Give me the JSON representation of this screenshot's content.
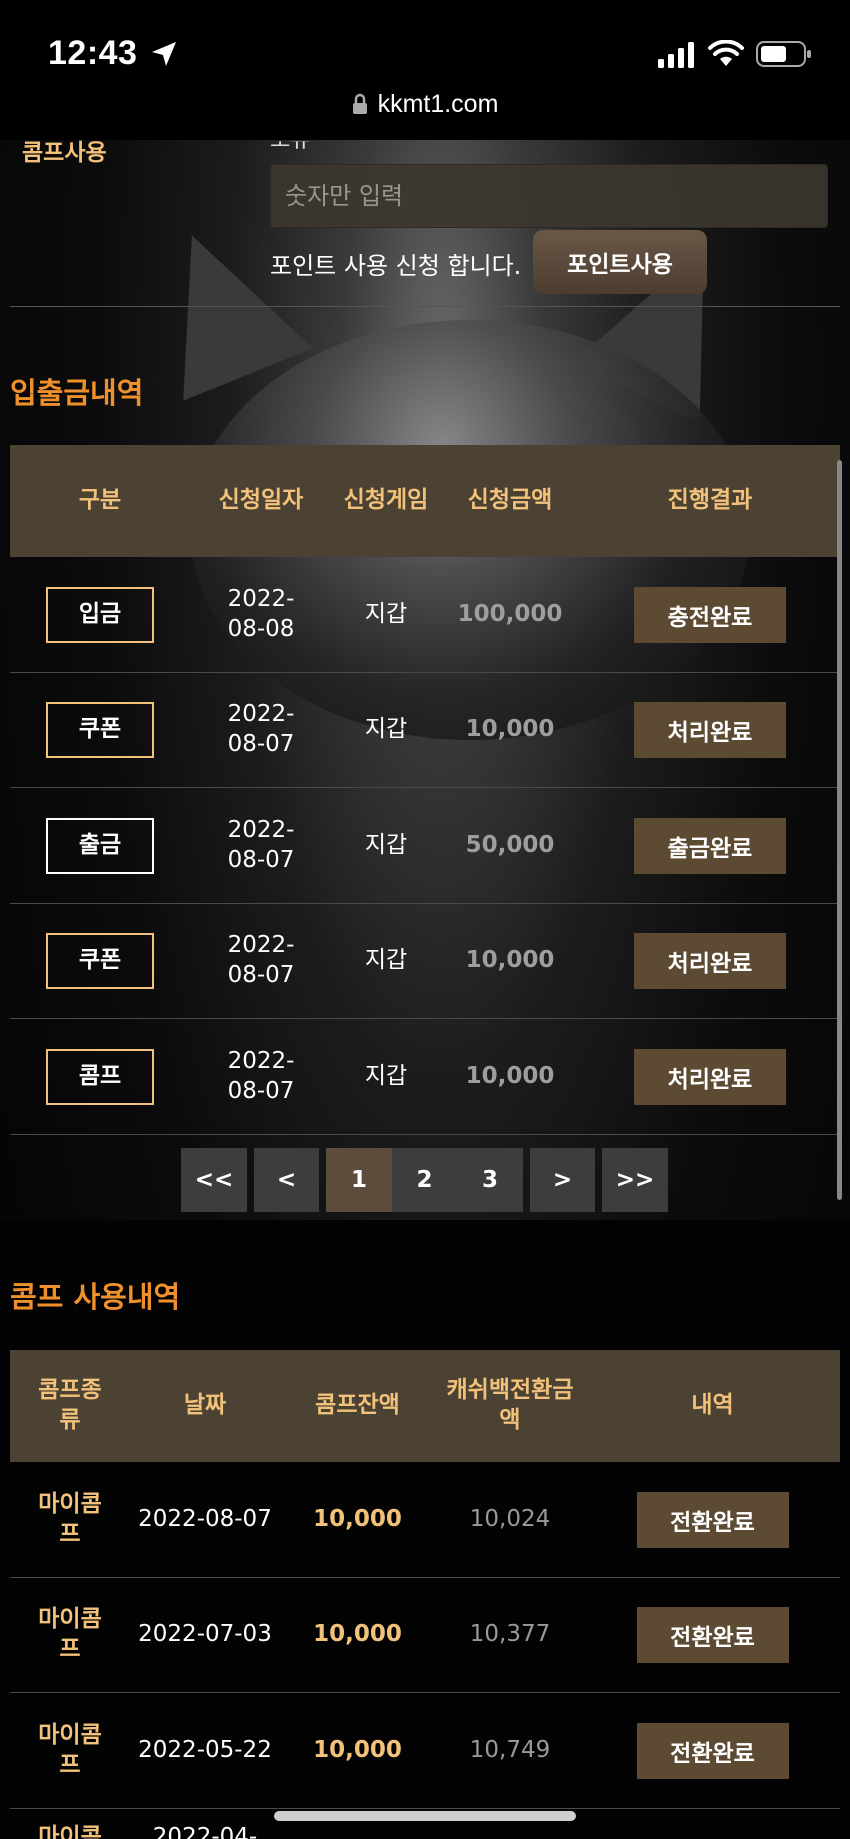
{
  "status": {
    "time": "12:43",
    "url": "kkmt1.com"
  },
  "comp_form": {
    "label": "콤프사용",
    "cut_text": "보유",
    "input_placeholder": "숫자만 입력",
    "notice": "포인트 사용 신청 합니다.",
    "button": "포인트사용"
  },
  "history": {
    "title": "입출금내역",
    "headers": [
      "구분",
      "신청일자",
      "신청게임",
      "신청금액",
      "진행결과"
    ],
    "rows": [
      {
        "type": "입금",
        "date": "2022-08-08",
        "game": "지갑",
        "amount": "100,000",
        "result": "충전완료"
      },
      {
        "type": "쿠폰",
        "date": "2022-08-07",
        "game": "지갑",
        "amount": "10,000",
        "result": "처리완료"
      },
      {
        "type": "출금",
        "date": "2022-08-07",
        "game": "지갑",
        "amount": "50,000",
        "result": "출금완료"
      },
      {
        "type": "쿠폰",
        "date": "2022-08-07",
        "game": "지갑",
        "amount": "10,000",
        "result": "처리완료"
      },
      {
        "type": "콤프",
        "date": "2022-08-07",
        "game": "지갑",
        "amount": "10,000",
        "result": "처리완료"
      }
    ]
  },
  "pagination": {
    "first": "<<",
    "prev": "<",
    "pages": [
      "1",
      "2",
      "3"
    ],
    "current": "1",
    "next": ">",
    "last": ">>"
  },
  "comp_history": {
    "title": "콤프 사용내역",
    "headers": [
      "콤프종류",
      "날짜",
      "콤프잔액",
      "캐쉬백전환금액",
      "내역"
    ],
    "rows": [
      {
        "type": "마이콤프",
        "date": "2022-08-07",
        "balance": "10,000",
        "cashback": "10,024",
        "status": "전환완료"
      },
      {
        "type": "마이콤프",
        "date": "2022-07-03",
        "balance": "10,000",
        "cashback": "10,377",
        "status": "전환완료"
      },
      {
        "type": "마이콤프",
        "date": "2022-05-22",
        "balance": "10,000",
        "cashback": "10,749",
        "status": "전환완료"
      },
      {
        "type": "마이콤프",
        "date": "2022-04-",
        "balance": "",
        "cashback": "",
        "status": ""
      }
    ]
  }
}
